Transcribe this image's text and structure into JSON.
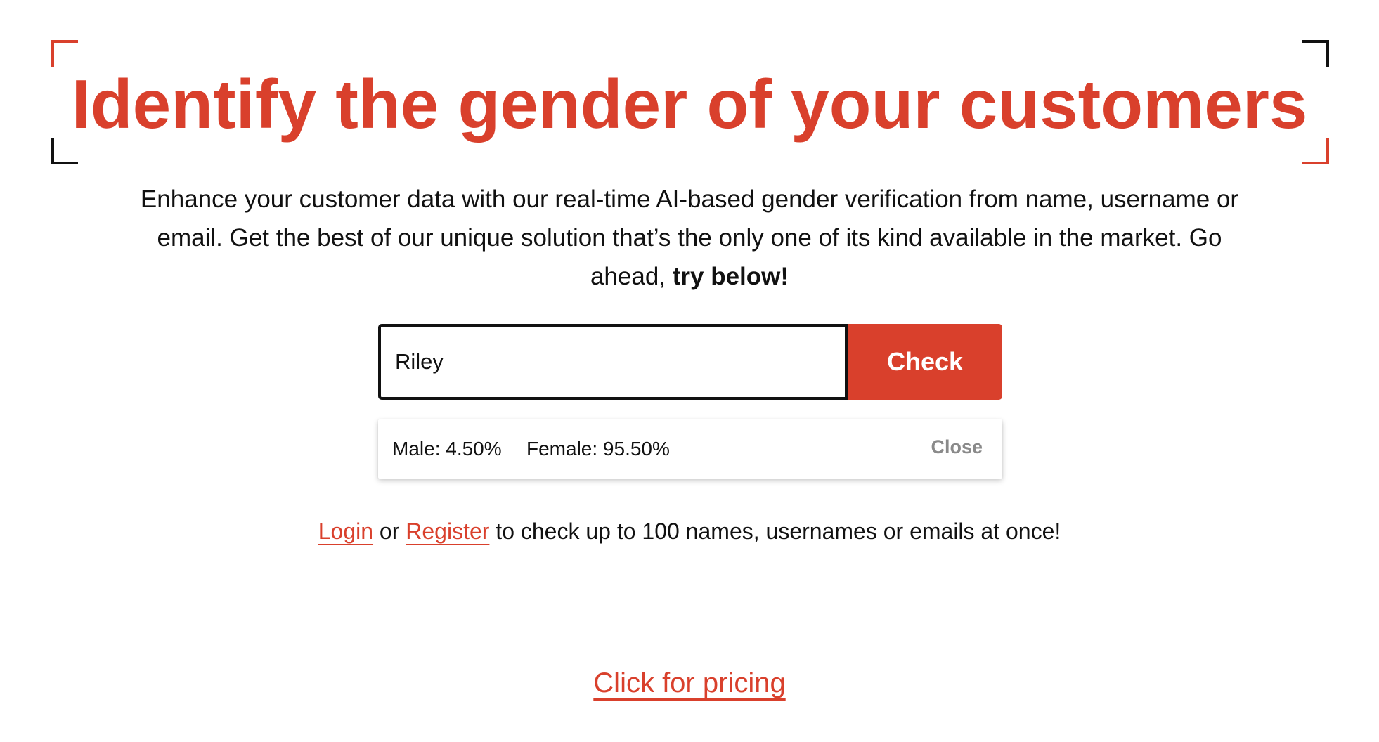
{
  "hero": {
    "title": "Identify the gender of your customers",
    "description": "Enhance your customer data with our real-time AI-based gender verification from name, username or email. Get the best of our unique solution that’s the only one of its kind available in the market. Go ahead, ",
    "description_emphasis": "try below!"
  },
  "search": {
    "value": "Riley",
    "button_label": "Check"
  },
  "result": {
    "male": "Male: 4.50%",
    "female": "Female: 95.50%",
    "close_label": "Close"
  },
  "account": {
    "login_label": "Login",
    "or_text": " or ",
    "register_label": "Register",
    "suffix_text": " to check up to 100 names, usernames or emails at once!"
  },
  "pricing": {
    "link_label": "Click for pricing"
  },
  "colors": {
    "accent": "#d9402c",
    "text": "#111111",
    "muted": "#8a8a8a"
  },
  "icons": {
    "frame": "corner-bracket-icon"
  }
}
